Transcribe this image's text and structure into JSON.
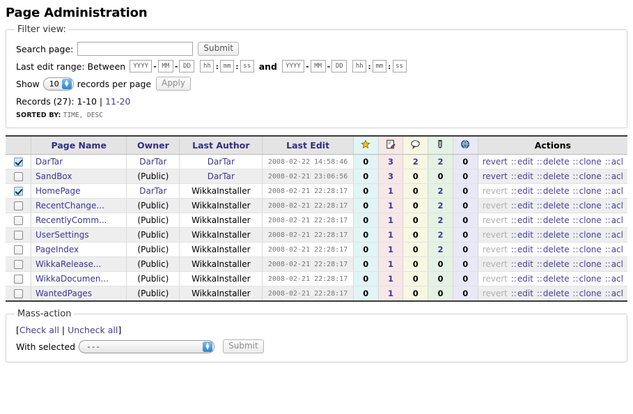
{
  "page_title": "Page Administration",
  "filter": {
    "legend": "Filter view:",
    "search_label": "Search page:",
    "search_value": "",
    "search_placeholder": "",
    "submit_label": "Submit",
    "range_label": "Last edit range: Between",
    "and_label": "and",
    "date_fields": {
      "yyyy": "YYYY",
      "mm": "MM",
      "dd": "DD",
      "hh": "hh",
      "min": "mm",
      "ss": "ss",
      "dash": "-",
      "colon": ":"
    },
    "show_label": "Show",
    "per_page_value": "10",
    "per_page_suffix": "records per page",
    "apply_label": "Apply",
    "records_label": "Records (27):",
    "records_current": "1-10",
    "records_divider": "|",
    "records_next": "11-20",
    "sorted_by_label": "SORTED BY:",
    "sorted_by_value": "TIME, DESC"
  },
  "table": {
    "headers": {
      "check": "",
      "page_name": "Page Name",
      "owner": "Owner",
      "last_author": "Last Author",
      "last_edit": "Last Edit",
      "actions": "Actions"
    },
    "icon_columns": [
      {
        "name": "star-icon",
        "title": "bookmarks"
      },
      {
        "name": "notepad-edit-icon",
        "title": "revisions"
      },
      {
        "name": "comment-bubble-icon",
        "title": "comments"
      },
      {
        "name": "referrer-icon",
        "title": "referrers"
      },
      {
        "name": "globe-icon",
        "title": "links"
      }
    ],
    "action_labels": {
      "revert": "revert",
      "edit": "edit",
      "delete": "delete",
      "clone": "clone",
      "acl": "acl",
      "separator": "::"
    },
    "rows": [
      {
        "checked": true,
        "page_name": "DarTar",
        "owner": "DarTar",
        "owner_is_link": true,
        "last_author": "DarTar",
        "author_is_link": true,
        "last_edit": "2008-02-22 14:58:46",
        "counts": [
          "0",
          "3",
          "2",
          "2",
          "0"
        ],
        "revert_enabled": true
      },
      {
        "checked": false,
        "page_name": "SandBox",
        "owner": "(Public)",
        "owner_is_link": false,
        "last_author": "DarTar",
        "author_is_link": true,
        "last_edit": "2008-02-21 23:06:56",
        "counts": [
          "0",
          "3",
          "0",
          "0",
          "0"
        ],
        "revert_enabled": true
      },
      {
        "checked": true,
        "page_name": "HomePage",
        "owner": "DarTar",
        "owner_is_link": true,
        "last_author": "WikkaInstaller",
        "author_is_link": false,
        "last_edit": "2008-02-21 22:28:17",
        "counts": [
          "0",
          "1",
          "0",
          "2",
          "0"
        ],
        "revert_enabled": false
      },
      {
        "checked": false,
        "page_name": "RecentChange...",
        "owner": "(Public)",
        "owner_is_link": false,
        "last_author": "WikkaInstaller",
        "author_is_link": false,
        "last_edit": "2008-02-21 22:28:17",
        "counts": [
          "0",
          "1",
          "0",
          "2",
          "0"
        ],
        "revert_enabled": false
      },
      {
        "checked": false,
        "page_name": "RecentlyComm...",
        "owner": "(Public)",
        "owner_is_link": false,
        "last_author": "WikkaInstaller",
        "author_is_link": false,
        "last_edit": "2008-02-21 22:28:17",
        "counts": [
          "0",
          "1",
          "0",
          "2",
          "0"
        ],
        "revert_enabled": false
      },
      {
        "checked": false,
        "page_name": "UserSettings",
        "owner": "(Public)",
        "owner_is_link": false,
        "last_author": "WikkaInstaller",
        "author_is_link": false,
        "last_edit": "2008-02-21 22:28:17",
        "counts": [
          "0",
          "1",
          "0",
          "2",
          "0"
        ],
        "revert_enabled": false
      },
      {
        "checked": false,
        "page_name": "PageIndex",
        "owner": "(Public)",
        "owner_is_link": false,
        "last_author": "WikkaInstaller",
        "author_is_link": false,
        "last_edit": "2008-02-21 22:28:17",
        "counts": [
          "0",
          "1",
          "0",
          "2",
          "0"
        ],
        "revert_enabled": false
      },
      {
        "checked": false,
        "page_name": "WikkaRelease...",
        "owner": "(Public)",
        "owner_is_link": false,
        "last_author": "WikkaInstaller",
        "author_is_link": false,
        "last_edit": "2008-02-21 22:28:17",
        "counts": [
          "0",
          "1",
          "0",
          "0",
          "0"
        ],
        "revert_enabled": false
      },
      {
        "checked": false,
        "page_name": "WikkaDocumen...",
        "owner": "(Public)",
        "owner_is_link": false,
        "last_author": "WikkaInstaller",
        "author_is_link": false,
        "last_edit": "2008-02-21 22:28:17",
        "counts": [
          "0",
          "1",
          "0",
          "0",
          "0"
        ],
        "revert_enabled": false
      },
      {
        "checked": false,
        "page_name": "WantedPages",
        "owner": "(Public)",
        "owner_is_link": false,
        "last_author": "WikkaInstaller",
        "author_is_link": false,
        "last_edit": "2008-02-21 22:28:17",
        "counts": [
          "0",
          "1",
          "0",
          "0",
          "0"
        ],
        "revert_enabled": false
      }
    ]
  },
  "mass_action": {
    "legend": "Mass-action",
    "bracket_open": "[",
    "check_all": "Check all",
    "divider": "|",
    "uncheck_all": "Uncheck all",
    "bracket_close": "]",
    "with_selected_label": "With selected",
    "select_value": "---",
    "submit_label": "Submit"
  },
  "colors": {
    "link": "#3b3597",
    "header_text": "#2f2f86",
    "disabled": "#b0b0b0",
    "row_alt": "#eeeeee"
  }
}
